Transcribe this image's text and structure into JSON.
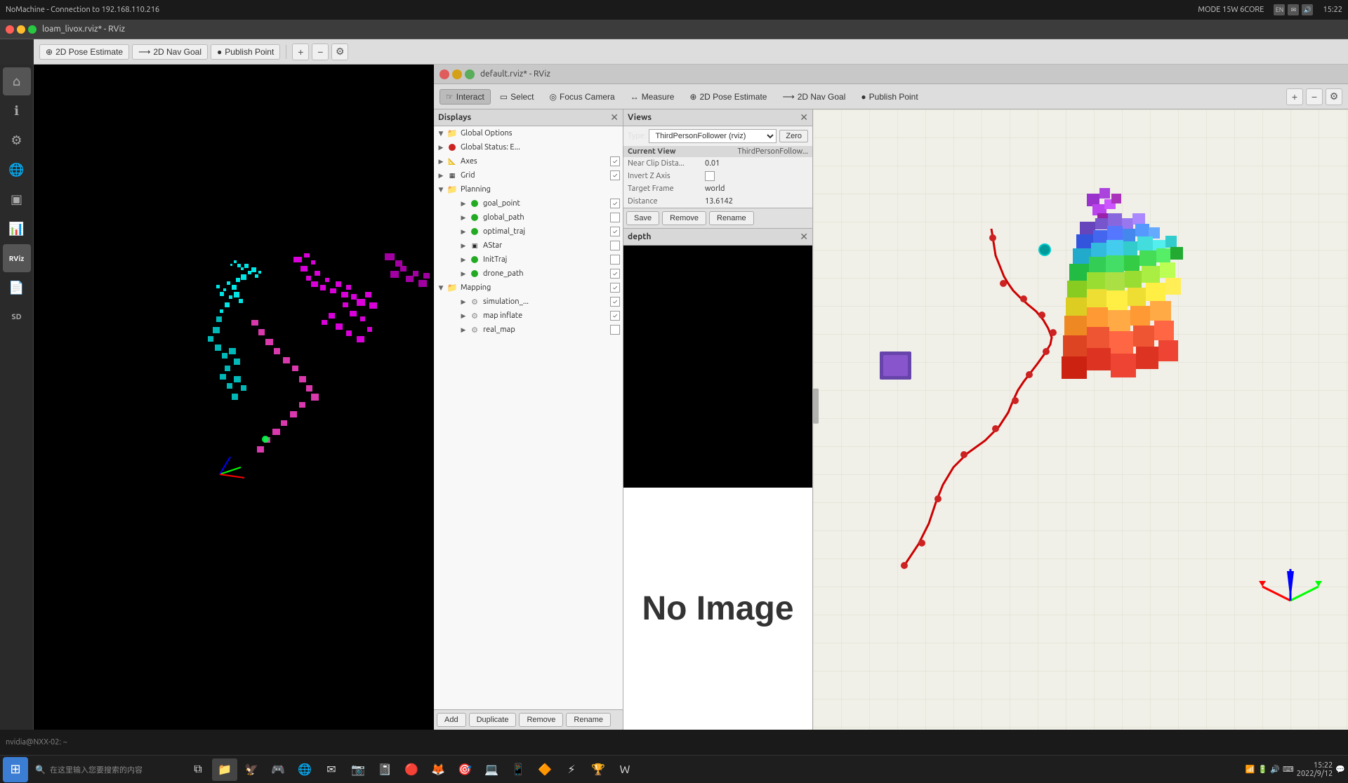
{
  "system": {
    "title": "NoMachine - Connection to 192.168.110.216",
    "time": "15:22",
    "date": "2022/9/12",
    "mode": "MODE 15W 6CORE"
  },
  "loam_window": {
    "title": "loam_livox.rviz* - RViz",
    "toolbar": {
      "pose_estimate": "2D Pose Estimate",
      "nav_goal": "2D Nav Goal",
      "publish_point": "Publish Point"
    }
  },
  "rviz_window": {
    "title": "default.rviz* - RViz",
    "toolbar": {
      "interact": "Interact",
      "select": "Select",
      "focus_camera": "Focus Camera",
      "measure": "Measure",
      "pose_estimate": "2D Pose Estimate",
      "nav_goal": "2D Nav Goal",
      "publish_point": "Publish Point"
    }
  },
  "displays": {
    "panel_title": "Displays",
    "items": [
      {
        "id": "global_options",
        "label": "Global Options",
        "indent": 0,
        "type": "folder",
        "expanded": true,
        "checked": null
      },
      {
        "id": "global_status",
        "label": "Global Status: E...",
        "indent": 0,
        "type": "error",
        "expanded": false,
        "checked": null
      },
      {
        "id": "axes",
        "label": "Axes",
        "indent": 0,
        "type": "item",
        "expanded": false,
        "checked": true
      },
      {
        "id": "grid",
        "label": "Grid",
        "indent": 0,
        "type": "item",
        "expanded": false,
        "checked": true
      },
      {
        "id": "planning",
        "label": "Planning",
        "indent": 0,
        "type": "folder",
        "expanded": true,
        "checked": null
      },
      {
        "id": "goal_point",
        "label": "goal_point",
        "indent": 1,
        "type": "green",
        "expanded": false,
        "checked": true
      },
      {
        "id": "global_path",
        "label": "global_path",
        "indent": 1,
        "type": "green",
        "expanded": false,
        "checked": false
      },
      {
        "id": "optimal_traj",
        "label": "optimal_traj",
        "indent": 1,
        "type": "green",
        "expanded": false,
        "checked": true
      },
      {
        "id": "astar",
        "label": "AStar",
        "indent": 1,
        "type": "item",
        "expanded": false,
        "checked": false
      },
      {
        "id": "inittraj",
        "label": "InitTraj",
        "indent": 1,
        "type": "green",
        "expanded": false,
        "checked": false
      },
      {
        "id": "drone_path",
        "label": "drone_path",
        "indent": 1,
        "type": "green",
        "expanded": false,
        "checked": true
      },
      {
        "id": "mapping",
        "label": "Mapping",
        "indent": 0,
        "type": "folder",
        "expanded": true,
        "checked": true
      },
      {
        "id": "simulation",
        "label": "simulation_...",
        "indent": 1,
        "type": "gear",
        "expanded": false,
        "checked": true
      },
      {
        "id": "map_inflate",
        "label": "map inflate",
        "indent": 1,
        "type": "gear",
        "expanded": false,
        "checked": true
      },
      {
        "id": "real_map",
        "label": "real_map",
        "indent": 1,
        "type": "gear",
        "expanded": false,
        "checked": false
      }
    ],
    "buttons": {
      "add": "Add",
      "duplicate": "Duplicate",
      "remove": "Remove",
      "rename": "Rename"
    }
  },
  "views": {
    "panel_title": "Views",
    "type_label": "Type:",
    "type_value": "ThirdPersonFollower (rviz)",
    "zero_btn": "Zero",
    "current_view_label": "Current View",
    "current_view_type": "ThirdPersonFollow...",
    "properties": [
      {
        "label": "Near Clip Dista...",
        "value": "0.01"
      },
      {
        "label": "Invert Z Axis",
        "value": ""
      },
      {
        "label": "Target Frame",
        "value": "world"
      },
      {
        "label": "Distance",
        "value": "13.6142"
      }
    ],
    "buttons": {
      "save": "Save",
      "remove": "Remove",
      "rename": "Rename"
    }
  },
  "depth": {
    "panel_title": "depth",
    "no_image_text": "No Image"
  },
  "taskbar": {
    "search_placeholder": "在这里输入您要搜索的内容",
    "time": "15:22",
    "date": "2022/9/12"
  }
}
